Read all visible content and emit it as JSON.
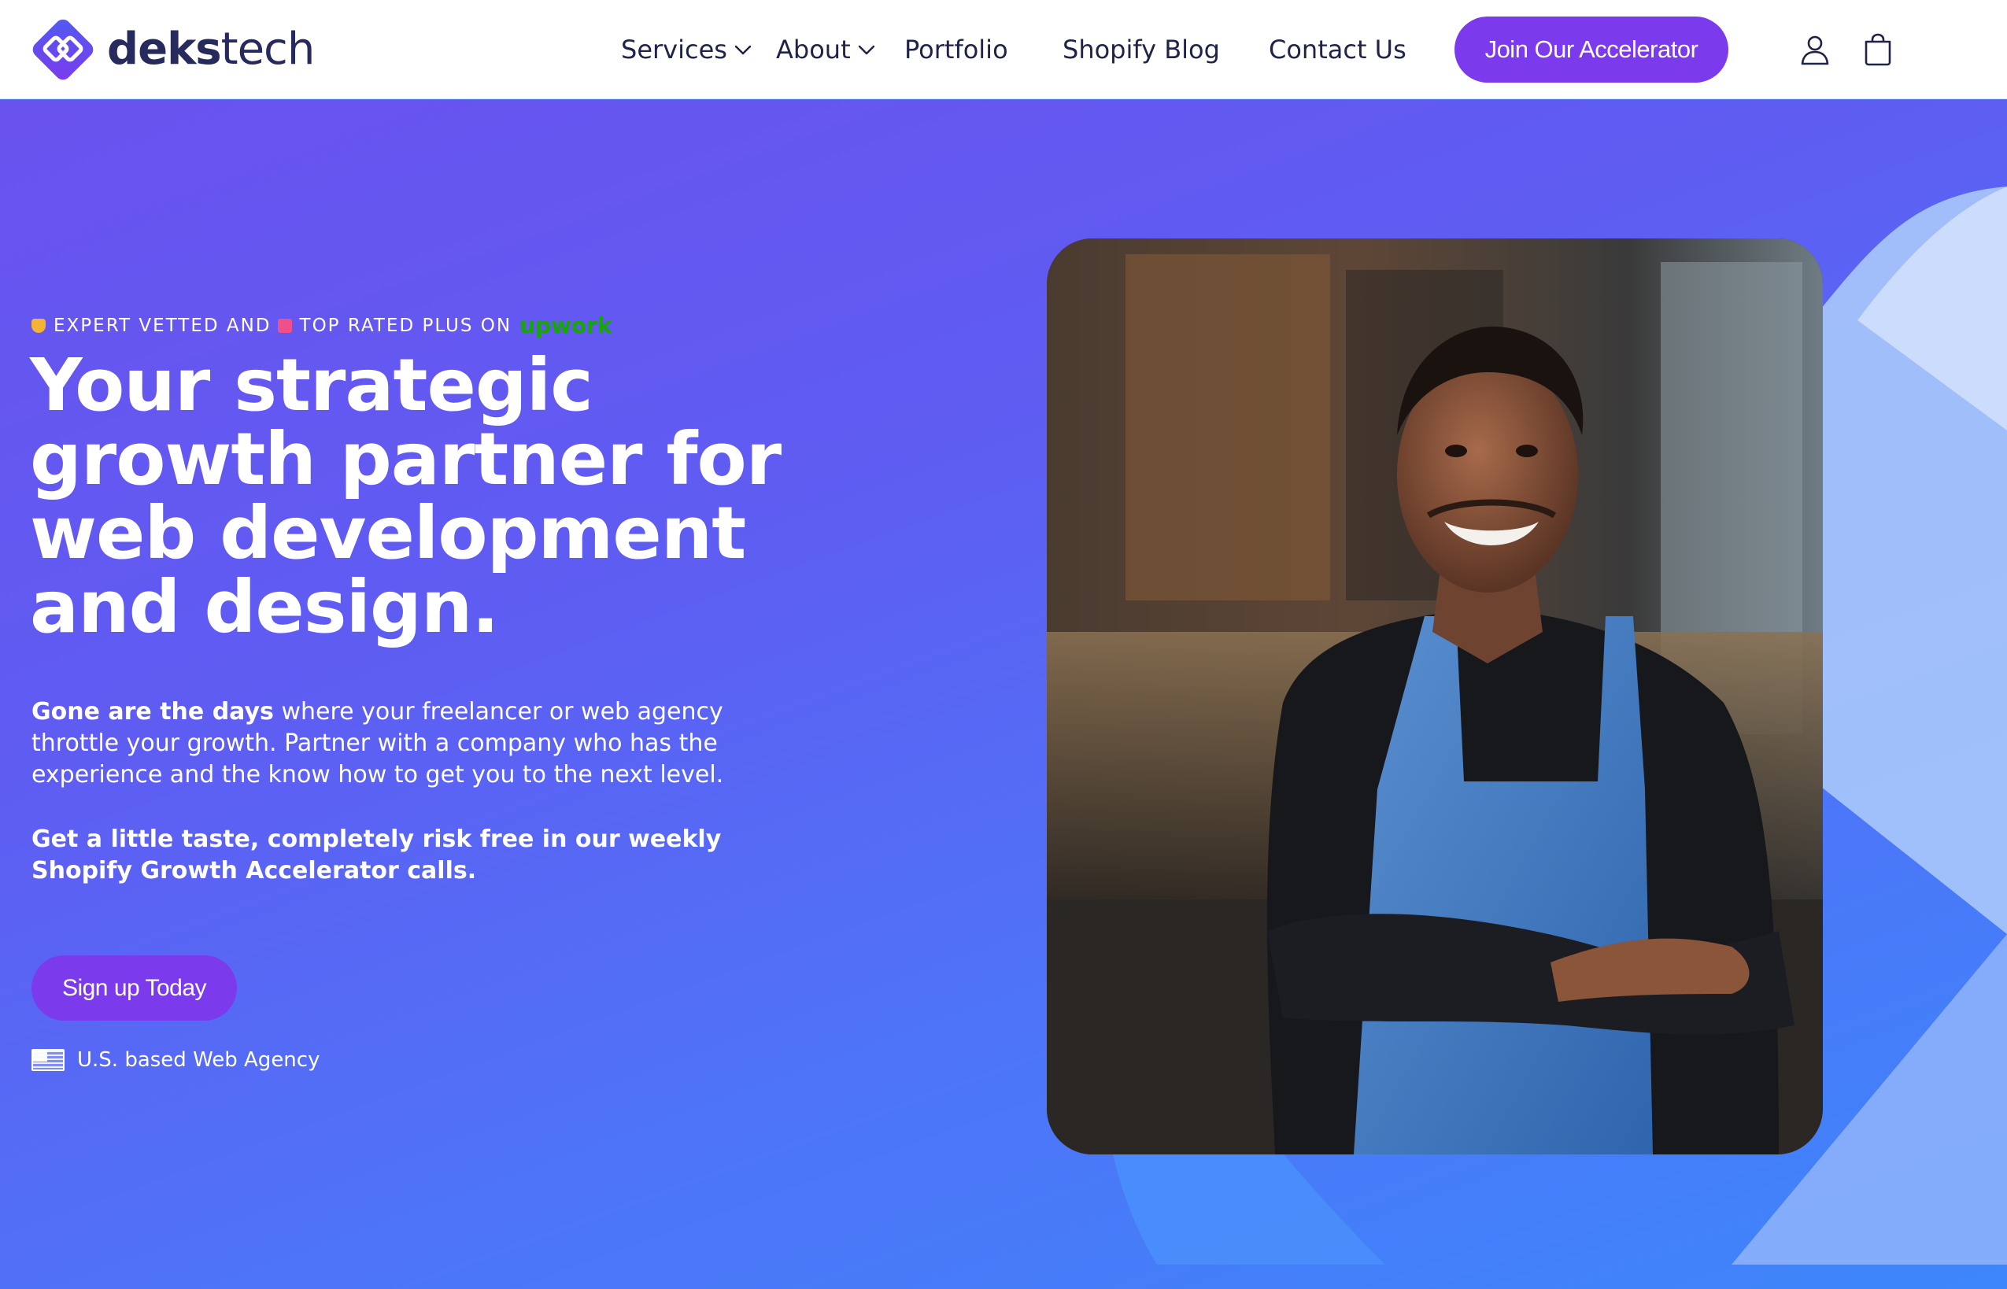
{
  "brand": {
    "name_bold": "deks",
    "name_light": "tech",
    "logo_icon": "diamond-logo-icon",
    "accent_color": "#7c3aed",
    "text_color": "#262a5c"
  },
  "nav": {
    "services": "Services",
    "about": "About",
    "portfolio": "Portfolio",
    "blog": "Shopify Blog",
    "contact": "Contact Us",
    "cta": "Join Our Accelerator",
    "account_icon": "user-icon",
    "cart_icon": "bag-icon"
  },
  "hero": {
    "badge_part1": "EXPERT VETTED AND",
    "badge_part2": "TOP RATED PLUS ON",
    "badge_brand": "upwork",
    "headline": "Your strategic growth partner for web development and design.",
    "para1_bold": "Gone are the days",
    "para1_rest": " where your freelancer or web agency throttle your growth. Partner with a company who has the experience and the know how to get you to the next level.",
    "para2": "Get a little taste, completely risk free in our weekly Shopify Growth Accelerator calls.",
    "cta": "Sign up Today",
    "location": "U.S. based Web Agency",
    "flag_icon": "us-flag-icon",
    "background_start": "#6a52ef",
    "background_end": "#3d86fb"
  }
}
